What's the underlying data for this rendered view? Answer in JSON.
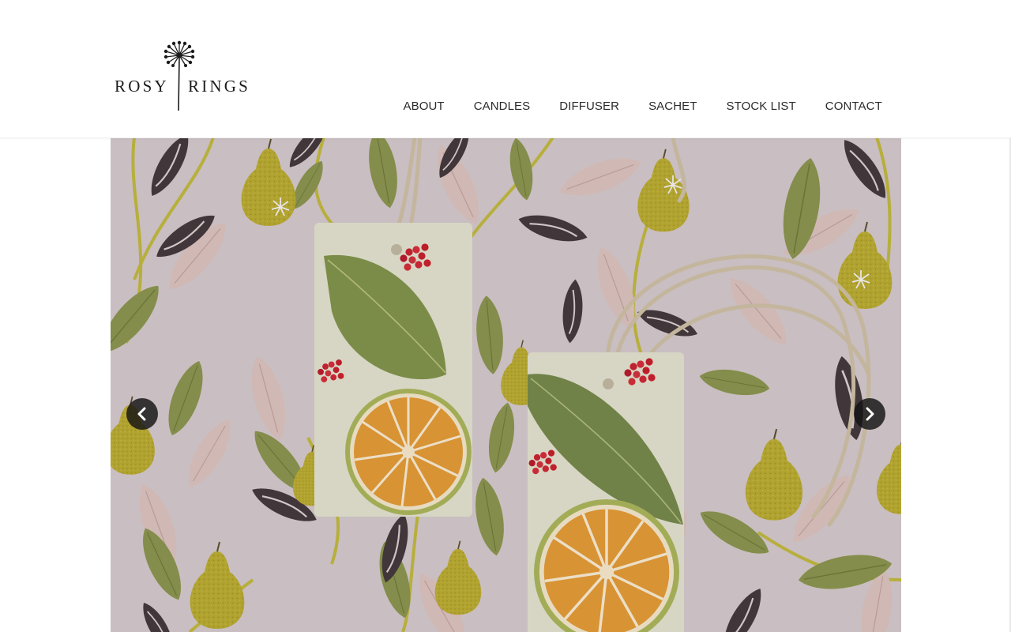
{
  "brand": {
    "name_left": "ROSY",
    "name_right": "RINGS",
    "logo_icon": "dandelion-icon"
  },
  "nav": {
    "items": [
      {
        "label": "ABOUT"
      },
      {
        "label": "CANDLES"
      },
      {
        "label": "DIFFUSER"
      },
      {
        "label": "SACHET"
      },
      {
        "label": "STOCK LIST"
      },
      {
        "label": "CONTACT"
      }
    ]
  },
  "slider": {
    "prev_icon": "chevron-left-icon",
    "next_icon": "chevron-right-icon",
    "image_subject": "botanical-wax-sachets-on-pear-pattern"
  },
  "colors": {
    "background": "#ffffff",
    "nav_text": "#2b2b2b",
    "arrow_bg": "#1a1a1a",
    "pattern_bg": "#ddd2d4",
    "leaf_olive": "#8a9a4a",
    "leaf_dark": "#3d3537",
    "pear_yellow": "#c2b430"
  }
}
